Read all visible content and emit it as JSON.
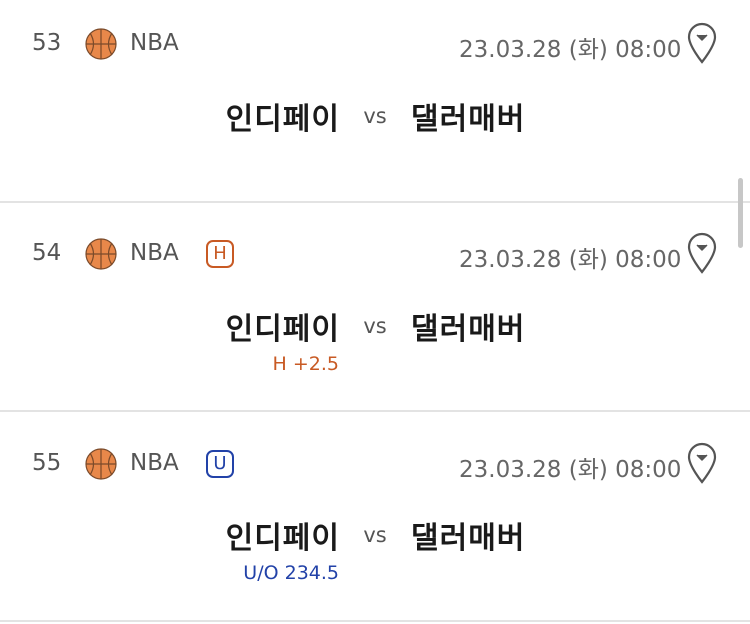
{
  "matches": [
    {
      "number": "53",
      "league": "NBA",
      "badge": "",
      "datetime": "23.03.28 (화) 08:00",
      "home_team": "인디페이",
      "vs": "vs",
      "away_team": "댈러매버",
      "handicap": ""
    },
    {
      "number": "54",
      "league": "NBA",
      "badge": "H",
      "datetime": "23.03.28 (화) 08:00",
      "home_team": "인디페이",
      "vs": "vs",
      "away_team": "댈러매버",
      "handicap": "H +2.5"
    },
    {
      "number": "55",
      "league": "NBA",
      "badge": "U",
      "datetime": "23.03.28 (화) 08:00",
      "home_team": "인디페이",
      "vs": "vs",
      "away_team": "댈러매버",
      "handicap": "U/O 234.5"
    }
  ],
  "icons": {
    "league_icon": "basketball-icon",
    "pin_icon": "location-pin-icon"
  },
  "colors": {
    "handicap": "#c85a24",
    "under_over": "#2242a8",
    "basketball": "#e8884a",
    "divider": "#e3e3e3"
  }
}
